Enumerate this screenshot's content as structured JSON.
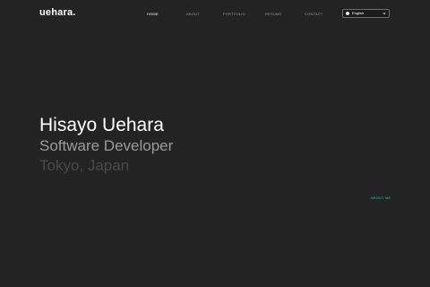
{
  "brand": {
    "logo": "uehara."
  },
  "nav": {
    "items": [
      {
        "label": "HOME",
        "active": true
      },
      {
        "label": "ABOUT",
        "active": false
      },
      {
        "label": "PORTFOLIO",
        "active": false
      },
      {
        "label": "RESUME",
        "active": false
      },
      {
        "label": "CONTACT",
        "active": false
      }
    ]
  },
  "language": {
    "selected": "English",
    "icon": "globe-icon"
  },
  "hero": {
    "name": "Hisayo Uehara",
    "role": "Software Developer",
    "location": "Tokyo, Japan",
    "cta_label": "ABOUT ME"
  },
  "colors": {
    "background": "#232324",
    "accent": "#22c4a8",
    "text_primary": "#ffffff",
    "text_secondary": "#9b9b9b",
    "text_muted": "#4a4a4b"
  }
}
